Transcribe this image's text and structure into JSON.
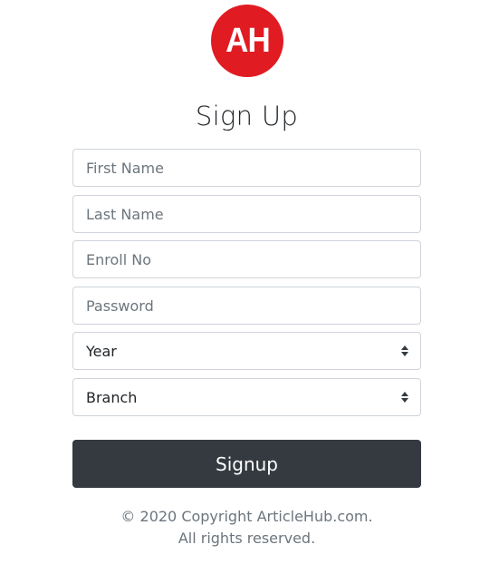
{
  "logo": {
    "text": "AH",
    "color": "#e11b22"
  },
  "page_title": "Sign Up",
  "form": {
    "first_name_placeholder": "First Name",
    "last_name_placeholder": "Last Name",
    "enroll_placeholder": "Enroll No",
    "password_placeholder": "Password",
    "year_selected": "Year",
    "branch_selected": "Branch",
    "submit_label": "Signup"
  },
  "footer": {
    "line1": "© 2020 Copyright ArticleHub.com.",
    "line2": "All rights reserved."
  },
  "colors": {
    "button_bg": "#343a40",
    "input_border": "#ced4da",
    "placeholder": "#6c757d"
  },
  "icons": {
    "select_arrow": "sort-arrows-icon"
  }
}
